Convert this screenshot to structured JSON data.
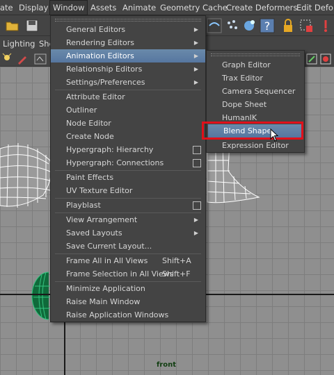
{
  "menubar": {
    "items": [
      "ate",
      "Display",
      "Window",
      "Assets",
      "Animate",
      "Geometry Cache",
      "Create Deformers",
      "Edit Deform"
    ],
    "active": "Window"
  },
  "shelf": {
    "tabs": [
      "Lighting",
      "Sho"
    ]
  },
  "viewport": {
    "camera_label": "front"
  },
  "window_menu": {
    "items": [
      {
        "label": "General Editors",
        "submenu": true
      },
      {
        "label": "Rendering Editors",
        "submenu": true
      },
      {
        "label": "Animation Editors",
        "submenu": true,
        "highlighted": true
      },
      {
        "label": "Relationship Editors",
        "submenu": true
      },
      {
        "label": "Settings/Preferences",
        "submenu": true
      },
      {
        "label": "Attribute Editor"
      },
      {
        "label": "Outliner"
      },
      {
        "label": "Node Editor"
      },
      {
        "label": "Create Node"
      },
      {
        "label": "Hypergraph: Hierarchy",
        "option_box": true
      },
      {
        "label": "Hypergraph: Connections",
        "option_box": true
      },
      {
        "label": "Paint Effects"
      },
      {
        "label": "UV Texture Editor"
      },
      {
        "label": "Playblast",
        "option_box": true
      },
      {
        "label": "View Arrangement",
        "submenu": true
      },
      {
        "label": "Saved Layouts",
        "submenu": true
      },
      {
        "label": "Save Current Layout..."
      },
      {
        "label": "Frame All in All Views",
        "shortcut": "Shift+A"
      },
      {
        "label": "Frame Selection in All Views",
        "shortcut": "Shift+F"
      },
      {
        "label": "Minimize Application"
      },
      {
        "label": "Raise Main Window"
      },
      {
        "label": "Raise Application Windows"
      }
    ]
  },
  "animation_submenu": {
    "items": [
      {
        "label": "Graph Editor"
      },
      {
        "label": "Trax Editor"
      },
      {
        "label": "Camera Sequencer"
      },
      {
        "label": "Dope Sheet"
      },
      {
        "label": "HumanIK"
      },
      {
        "label": "Blend Shape",
        "highlighted": true
      },
      {
        "label": "Expression Editor"
      }
    ]
  },
  "colors": {
    "highlight": "#5676a0",
    "callout": "#e0101a",
    "menu_bg": "#444444",
    "grid_bg": "#8f8f8f"
  }
}
